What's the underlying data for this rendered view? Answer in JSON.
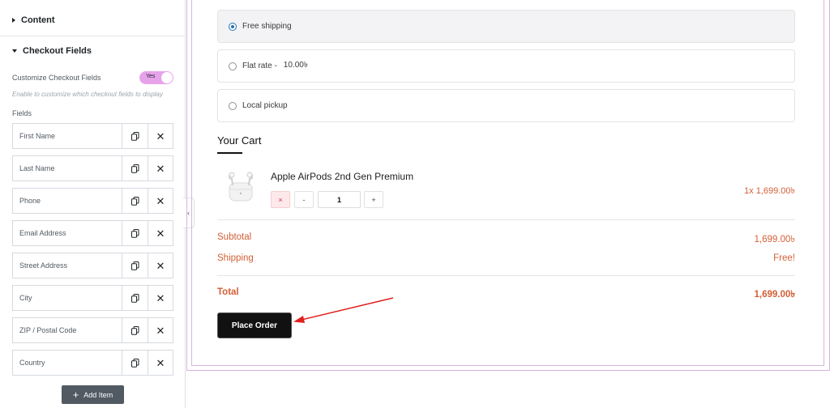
{
  "sidebar": {
    "content_label": "Content",
    "checkout_fields_label": "Checkout Fields",
    "customize_label": "Customize Checkout Fields",
    "customize_toggle": "Yes",
    "customize_desc": "Enable to customize which checkout fields to display",
    "fields_label": "Fields",
    "fields": [
      {
        "label": "First Name"
      },
      {
        "label": "Last Name"
      },
      {
        "label": "Phone"
      },
      {
        "label": "Email Address"
      },
      {
        "label": "Street Address"
      },
      {
        "label": "City"
      },
      {
        "label": "ZIP / Postal Code"
      },
      {
        "label": "Country"
      }
    ],
    "add_item_label": "Add Item",
    "collapse_glyph": "‹"
  },
  "shipping": {
    "options": [
      {
        "label": "Free shipping",
        "price": "",
        "selected": true
      },
      {
        "label": "Flat rate -",
        "price": "10.00৳",
        "selected": false
      },
      {
        "label": "Local pickup",
        "price": "",
        "selected": false
      }
    ]
  },
  "cart": {
    "title": "Your Cart",
    "product": {
      "name": "Apple AirPods 2nd Gen Premium",
      "remove_glyph": "×",
      "minus": "-",
      "qty": "1",
      "plus": "+",
      "line_price": "1x  1,699.00৳"
    },
    "subtotal_label": "Subtotal",
    "subtotal_value": "1,699.00৳",
    "shipping_label": "Shipping",
    "shipping_value": "Free!",
    "total_label": "Total",
    "total_value": "1,699.00৳",
    "place_order": "Place Order"
  },
  "colors": {
    "accent_price": "#d35f35",
    "toggle_on": "#e6a3ea",
    "preview_border": "#d6b4de",
    "annotation_arrow": "#e02020"
  }
}
